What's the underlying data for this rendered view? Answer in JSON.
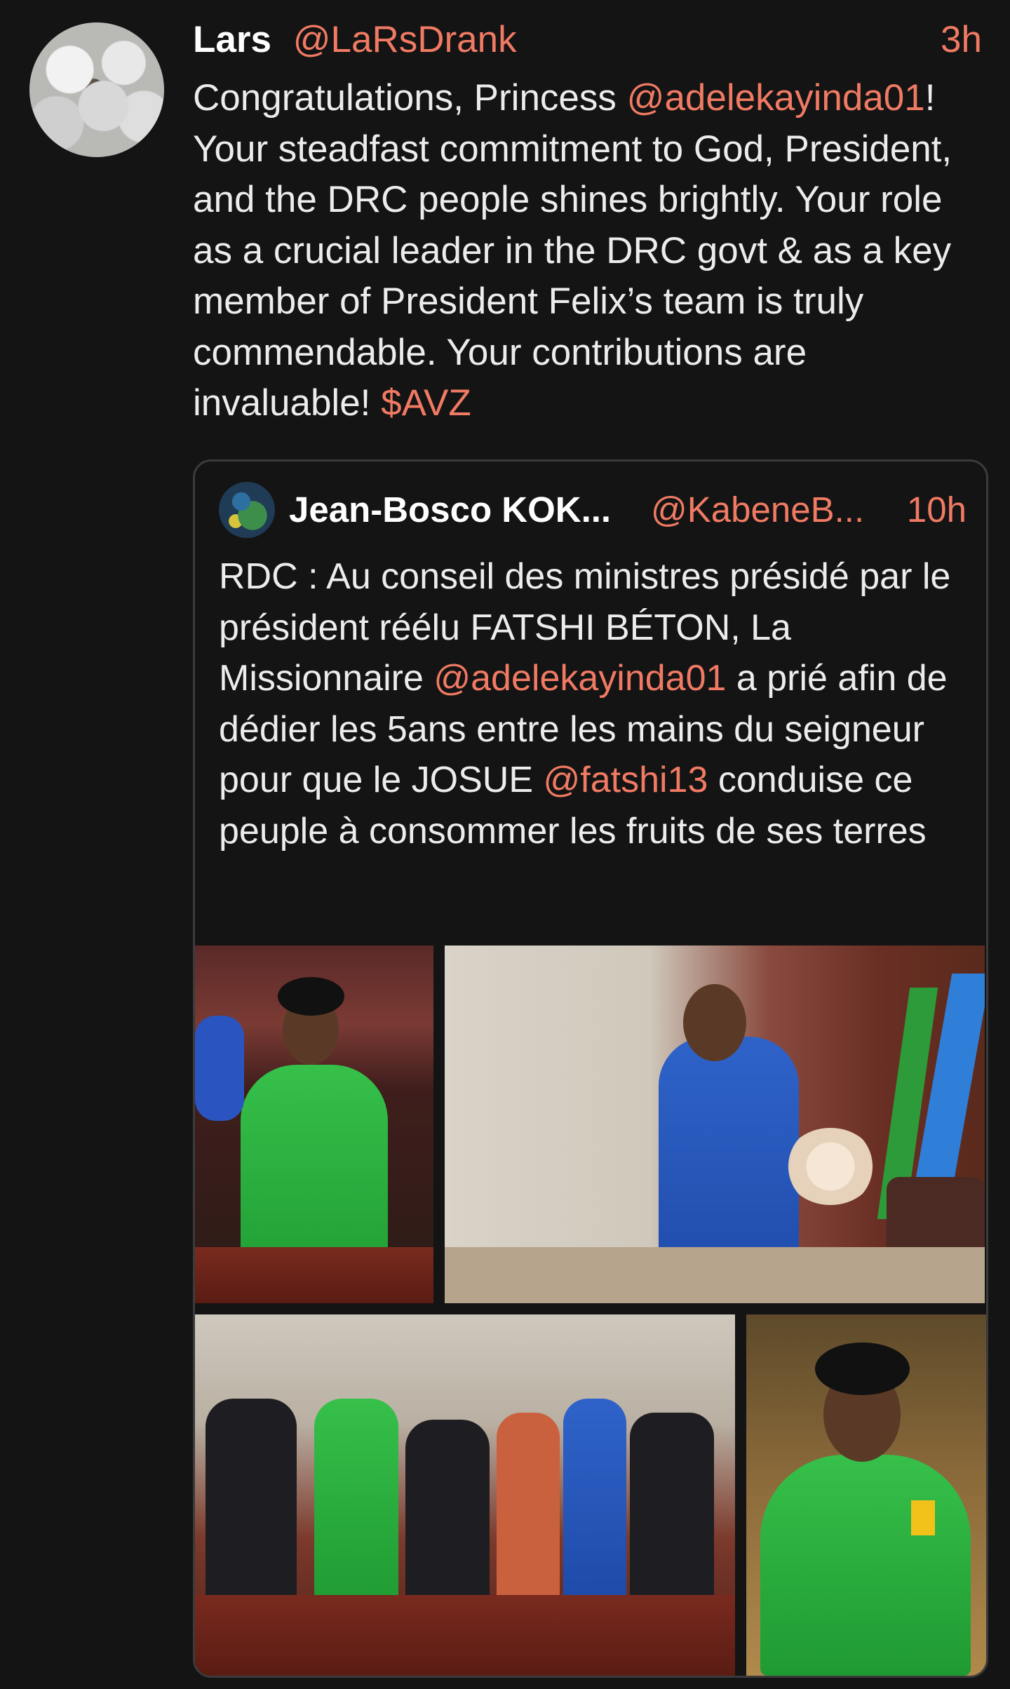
{
  "author": {
    "name": "Lars",
    "handle": "@LaRsDrank",
    "time": "3h",
    "avatar_icon": "avatar-icon"
  },
  "tweet": {
    "text_1": "Congratulations, Princess ",
    "mention_1": "@adelekayinda01",
    "text_2": "! Your steadfast commitment to God, President, and the DRC people shines brightly. Your role as a crucial leader in the DRC govt & as a key member of President Felix’s team is truly commendable. Your contributions are invaluable! ",
    "cashtag": "$AVZ"
  },
  "quoted": {
    "name": "Jean-Bosco KOK...",
    "handle": "@KabeneB...",
    "time": "10h",
    "avatar_icon": "avatar-icon",
    "text_1": "RDC : Au conseil des ministres présidé par le président réélu FATSHI BÉTON, La Missionnaire ",
    "mention_1": "@adelekayinda01",
    "text_2": " a prié afin de dédier les 5ans entre les mains du seigneur pour que le JOSUE ",
    "mention_2": "@fatshi13",
    "text_3": " conduise ce peuple à consommer les fruits de ses terres",
    "photos": [
      "photo-1",
      "photo-2",
      "photo-3",
      "photo-4"
    ]
  },
  "colors": {
    "background": "#141414",
    "text": "#ececec",
    "accent": "#f07a63",
    "border": "#3b3b3b"
  }
}
